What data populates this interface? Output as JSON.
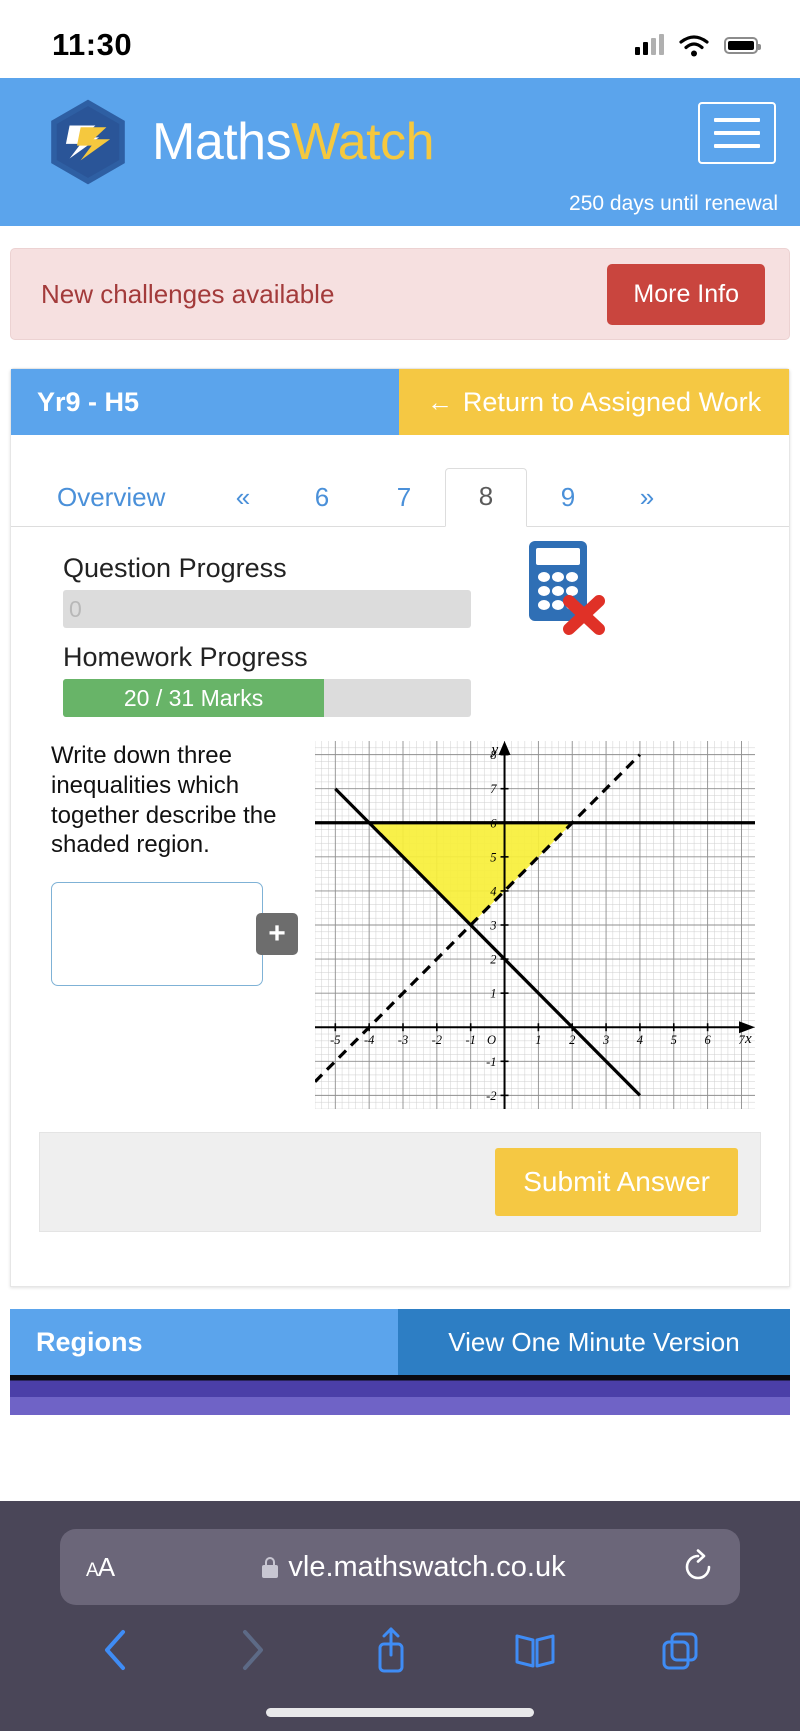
{
  "status_bar": {
    "time": "11:30",
    "signal_icon": "cellular-signal-icon",
    "wifi_icon": "wifi-icon",
    "battery_icon": "battery-icon"
  },
  "header": {
    "brand_first": "Maths",
    "brand_second": "Watch",
    "logo_icon": "mathswatch-logo-icon",
    "menu_icon": "hamburger-menu-icon",
    "renewal_text": "250 days until renewal",
    "bg_color": "#5ba4ec",
    "accent_color": "#f5c83e"
  },
  "alert": {
    "message": "New challenges available",
    "button_label": "More Info",
    "bg_color": "#f6e0e0",
    "text_color": "#a33b3b",
    "button_color": "#c9453e"
  },
  "assignment": {
    "title": "Yr9 - H5",
    "return_label": "Return to Assigned Work",
    "return_icon": "arrow-left-icon",
    "title_bg": "#5ba4ec",
    "return_bg": "#f5c843"
  },
  "tabs": [
    {
      "label": "Overview",
      "type": "overview",
      "active": false
    },
    {
      "label": "«",
      "type": "chevron",
      "active": false
    },
    {
      "label": "6",
      "type": "num",
      "active": false
    },
    {
      "label": "7",
      "type": "num",
      "active": false
    },
    {
      "label": "8",
      "type": "num",
      "active": true
    },
    {
      "label": "9",
      "type": "num",
      "active": false
    },
    {
      "label": "»",
      "type": "chevron",
      "active": false
    }
  ],
  "progress": {
    "question_label": "Question Progress",
    "question_value": "0",
    "question_percent": 0,
    "homework_label": "Homework Progress",
    "homework_value": "20 / 31 Marks",
    "homework_percent": 64,
    "fill_color": "#68b468",
    "track_color": "#dcdcdc"
  },
  "calculator": {
    "icon": "calculator-not-allowed-icon",
    "body_color": "#2f6fb5",
    "cross_color": "#e03127"
  },
  "question": {
    "text": "Write down three inequalities which together describe the shaded region.",
    "answer_value": "",
    "answer_placeholder": "",
    "add_button_label": "+"
  },
  "chart_data": {
    "type": "line",
    "title": "",
    "xlabel": "x",
    "ylabel": "y",
    "xlim": [
      -5.6,
      7.4
    ],
    "ylim": [
      -2.4,
      8.4
    ],
    "grid": true,
    "minor_grid": true,
    "x_ticks": [
      -5,
      -4,
      -3,
      -2,
      -1,
      0,
      1,
      2,
      3,
      4,
      5,
      6,
      7
    ],
    "x_tick_labels": [
      "-5",
      "-4",
      "-3",
      "-2",
      "-1",
      "O",
      "1",
      "2",
      "3",
      "4",
      "5",
      "6",
      "7"
    ],
    "y_ticks": [
      -2,
      -1,
      1,
      2,
      3,
      4,
      5,
      6,
      7,
      8
    ],
    "y_tick_labels": [
      "-2",
      "-1",
      "1",
      "2",
      "3",
      "4",
      "5",
      "6",
      "7",
      "8"
    ],
    "series": [
      {
        "name": "y = 6",
        "style": "solid",
        "color": "#000000",
        "points": [
          [
            -5.6,
            6
          ],
          [
            7.4,
            6
          ]
        ]
      },
      {
        "name": "y = -x + 2",
        "style": "solid",
        "color": "#000000",
        "points": [
          [
            -5,
            7
          ],
          [
            4,
            -2
          ]
        ]
      },
      {
        "name": "y = x + 4",
        "style": "dashed",
        "color": "#000000",
        "points": [
          [
            -5.6,
            -1.6
          ],
          [
            4,
            8
          ]
        ]
      }
    ],
    "shaded_region": {
      "label": "shaded region",
      "fill_color": "#f7ef3a",
      "vertices": [
        [
          -4,
          6
        ],
        [
          2,
          6
        ],
        [
          -1,
          3
        ]
      ]
    }
  },
  "submit": {
    "label": "Submit Answer",
    "bg_color": "#f5c843"
  },
  "regions": {
    "title": "Regions",
    "view_label": "View One Minute Version",
    "title_bg": "#5ba4ec",
    "view_bg": "#2d7ec4"
  },
  "safari": {
    "text_size_label": "AA",
    "lock_icon": "lock-icon",
    "url": "vle.mathswatch.co.uk",
    "reload_icon": "reload-icon",
    "back_icon": "back-chevron-icon",
    "forward_icon": "forward-chevron-icon",
    "share_icon": "share-icon",
    "bookmarks_icon": "bookmarks-book-icon",
    "tabs_icon": "tabs-icon"
  }
}
